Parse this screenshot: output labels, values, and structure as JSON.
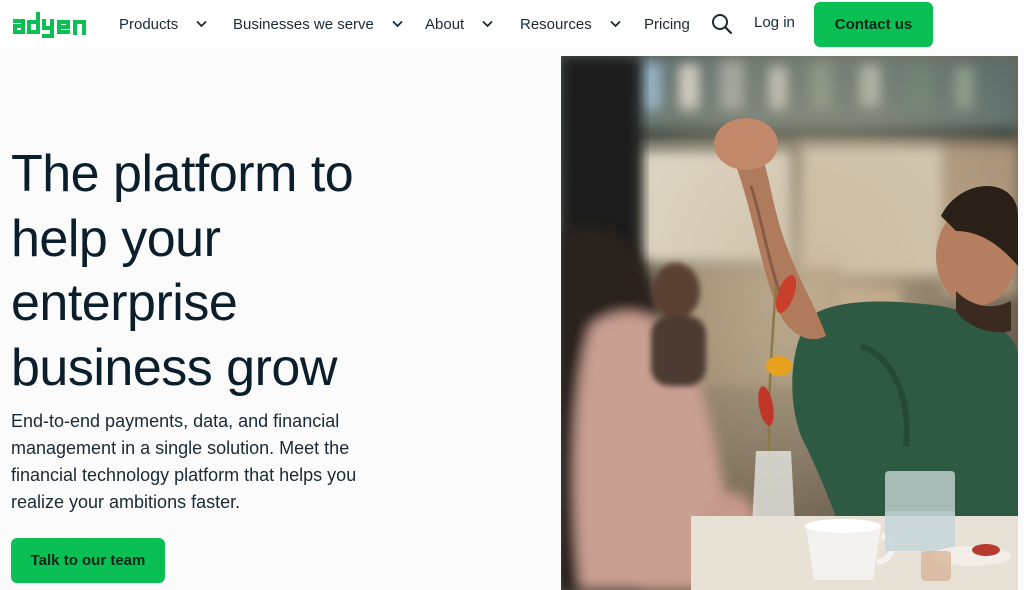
{
  "brand": {
    "logo_text": "adyen",
    "accent_color": "#0abf53",
    "text_color": "#0a1e2b"
  },
  "nav": {
    "items": [
      {
        "label": "Products",
        "has_dropdown": true
      },
      {
        "label": "Businesses we serve",
        "has_dropdown": true
      },
      {
        "label": "About",
        "has_dropdown": true
      },
      {
        "label": "Resources",
        "has_dropdown": true
      },
      {
        "label": "Pricing",
        "has_dropdown": false
      }
    ],
    "search_icon": "search-icon",
    "login_label": "Log in",
    "contact_label": "Contact us"
  },
  "hero": {
    "headline_lines": [
      "The platform to",
      "help your",
      "enterprise",
      "business grow"
    ],
    "subtext": "End-to-end payments, data, and financial management in a single solution. Meet the financial technology platform that helps you realize your ambitions faster.",
    "cta_label": "Talk to our team"
  }
}
